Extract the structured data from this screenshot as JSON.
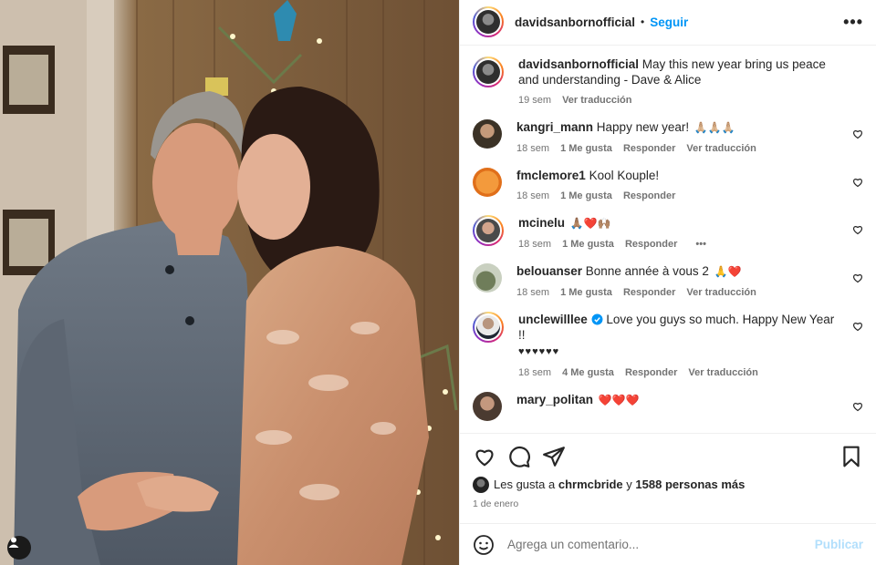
{
  "header": {
    "username": "davidsanbornofficial",
    "separator": "•",
    "follow_label": "Seguir",
    "more_icon": "more-horizontal-icon"
  },
  "caption": {
    "username": "davidsanbornofficial",
    "text": "May this new year bring us peace and understanding - Dave & Alice",
    "time": "19 sem",
    "translate": "Ver traducción"
  },
  "comments": [
    {
      "username": "kangri_mann",
      "text": "Happy new year!",
      "emoji": "🙏🏼🙏🏼🙏🏼",
      "time": "18 sem",
      "likes": "1 Me gusta",
      "reply": "Responder",
      "translate": "Ver traducción"
    },
    {
      "username": "fmclemore1",
      "text": "Kool Kouple!",
      "emoji": "",
      "time": "18 sem",
      "likes": "1 Me gusta",
      "reply": "Responder"
    },
    {
      "username": "mcinelu",
      "text": "",
      "emoji": "🙏🏽❤️🙌🏽",
      "time": "18 sem",
      "likes": "1 Me gusta",
      "reply": "Responder",
      "options": "•••"
    },
    {
      "username": "belouanser",
      "text": "Bonne année à vous 2",
      "emoji": "🙏❤️",
      "time": "18 sem",
      "likes": "1 Me gusta",
      "reply": "Responder",
      "translate": "Ver traducción"
    },
    {
      "username": "unclewilllee",
      "verified": true,
      "text": "Love you guys so much. Happy New Year !!",
      "text2": "♥♥♥♥♥♥",
      "time": "18 sem",
      "likes": "4 Me gusta",
      "reply": "Responder",
      "translate": "Ver traducción"
    },
    {
      "username": "mary_politan",
      "text": "",
      "emoji": "❤️❤️❤️"
    }
  ],
  "actions": {
    "like_icon": "heart-outline-icon",
    "comment_icon": "comment-icon",
    "share_icon": "paper-plane-icon",
    "save_icon": "bookmark-icon"
  },
  "likes": {
    "prefix": "Les gusta a",
    "user": "chrmcbride",
    "joiner": "y",
    "others": "1588 personas más"
  },
  "date": "1 de enero",
  "add_comment": {
    "placeholder": "Agrega un comentario...",
    "publish_label": "Publicar",
    "emoji_icon": "smiley-icon"
  },
  "colors": {
    "link_blue": "#0095f6",
    "publish_disabled": "#b2dffc",
    "secondary_text": "#737373",
    "verified_blue": "#0095f6"
  }
}
